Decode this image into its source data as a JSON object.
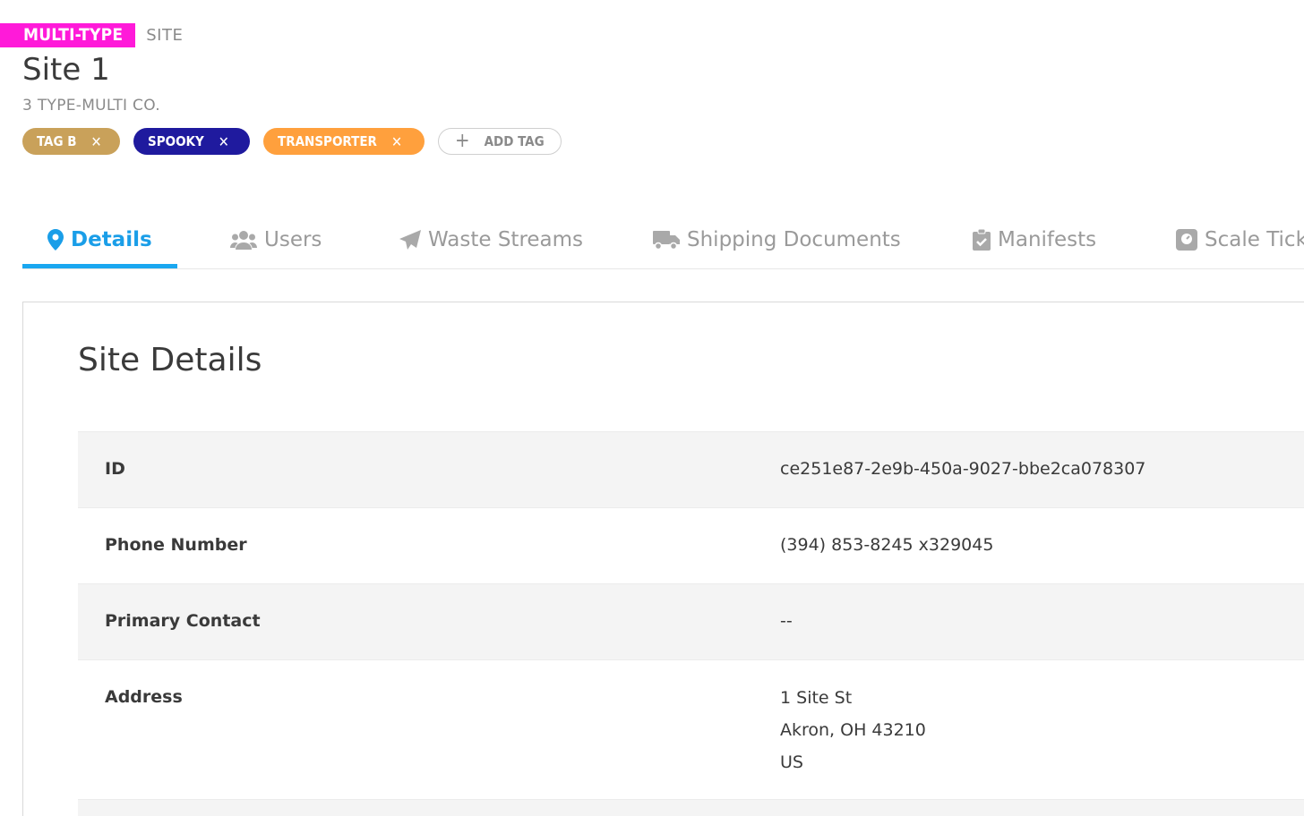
{
  "header": {
    "type_badge": "MULTI-TYPE",
    "type_label": "SITE",
    "title": "Site 1",
    "company": "3 TYPE-MULTI CO."
  },
  "tags": [
    {
      "label": "TAG B",
      "color": "#c9a15a"
    },
    {
      "label": "SPOOKY",
      "color": "#1f1a9e"
    },
    {
      "label": "TRANSPORTER",
      "color": "#ffa03d"
    }
  ],
  "add_tag_label": "ADD TAG",
  "tabs": [
    {
      "label": "Details",
      "icon": "map-marker-icon",
      "active": true
    },
    {
      "label": "Users",
      "icon": "users-icon"
    },
    {
      "label": "Waste Streams",
      "icon": "paper-plane-icon"
    },
    {
      "label": "Shipping Documents",
      "icon": "truck-icon"
    },
    {
      "label": "Manifests",
      "icon": "clipboard-check-icon"
    },
    {
      "label": "Scale Tick",
      "icon": "scale-icon"
    }
  ],
  "details": {
    "title": "Site Details",
    "rows": [
      {
        "label": "ID",
        "value": "ce251e87-2e9b-450a-9027-bbe2ca078307"
      },
      {
        "label": "Phone Number",
        "value": "(394) 853-8245 x329045"
      },
      {
        "label": "Primary Contact",
        "value": "--"
      },
      {
        "label": "Address",
        "lines": [
          "1 Site St",
          "Akron, OH 43210",
          "US"
        ]
      }
    ]
  },
  "colors": {
    "accent": "#1a9ee8",
    "type_badge": "#ff1ad9"
  }
}
